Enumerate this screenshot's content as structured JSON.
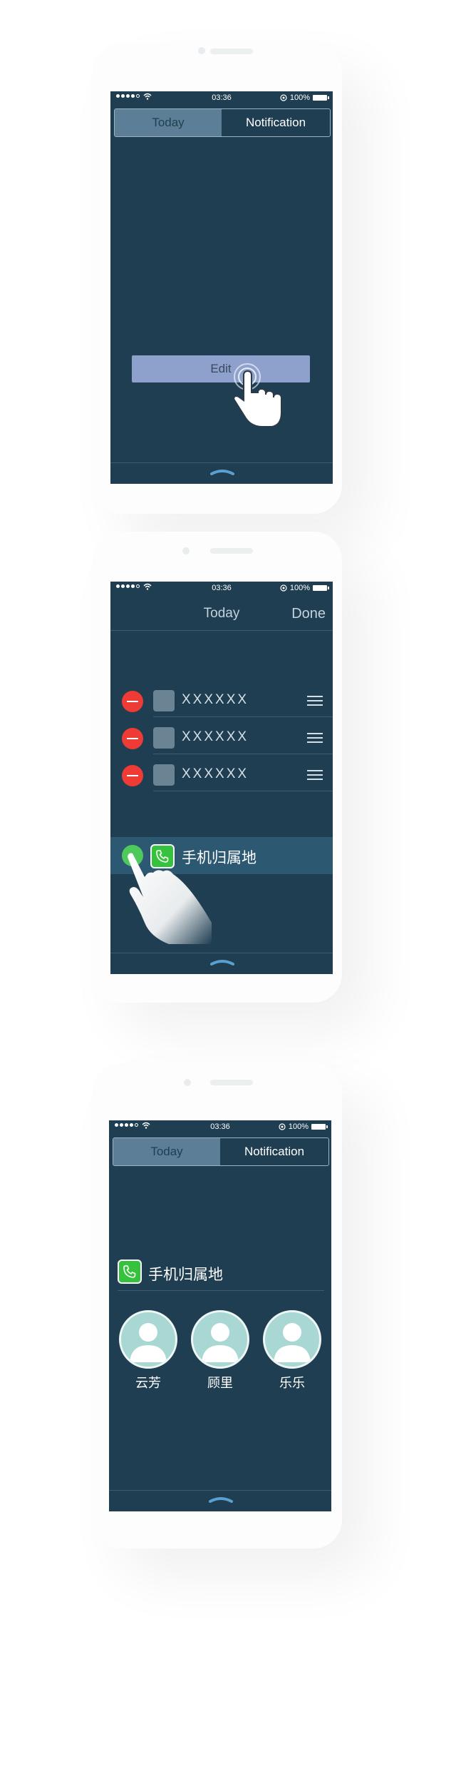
{
  "colors": {
    "screen_bg": "#1f3e51",
    "segment_selected": "#5c7f97",
    "edit_button": "#8ea0cc",
    "remove_red": "#ef3b35",
    "add_green": "#4ec95c",
    "app_green": "#37c23d",
    "avatar_teal": "#a9d7d3",
    "handle_blue": "#5aa0d0"
  },
  "screen1": {
    "status": {
      "time": "03:36",
      "battery": "100%"
    },
    "tabs": {
      "today": "Today",
      "notification": "Notification"
    },
    "edit_label": "Edit"
  },
  "screen2": {
    "status": {
      "time": "03:36",
      "battery": "100%"
    },
    "nav": {
      "title": "Today",
      "done": "Done"
    },
    "rows": [
      {
        "label": "XXXXXX"
      },
      {
        "label": "XXXXXX"
      },
      {
        "label": "XXXXXX"
      }
    ],
    "added_widget": {
      "label": "手机归属地",
      "icon": "phone-icon"
    }
  },
  "screen3": {
    "status": {
      "time": "03:36",
      "battery": "100%"
    },
    "tabs": {
      "today": "Today",
      "notification": "Notification"
    },
    "widget_title": "手机归属地",
    "contacts": [
      {
        "name": "云芳",
        "icon": "person-avatar-icon"
      },
      {
        "name": "顾里",
        "icon": "person-avatar-icon"
      },
      {
        "name": "乐乐",
        "icon": "person-avatar-icon"
      }
    ]
  }
}
